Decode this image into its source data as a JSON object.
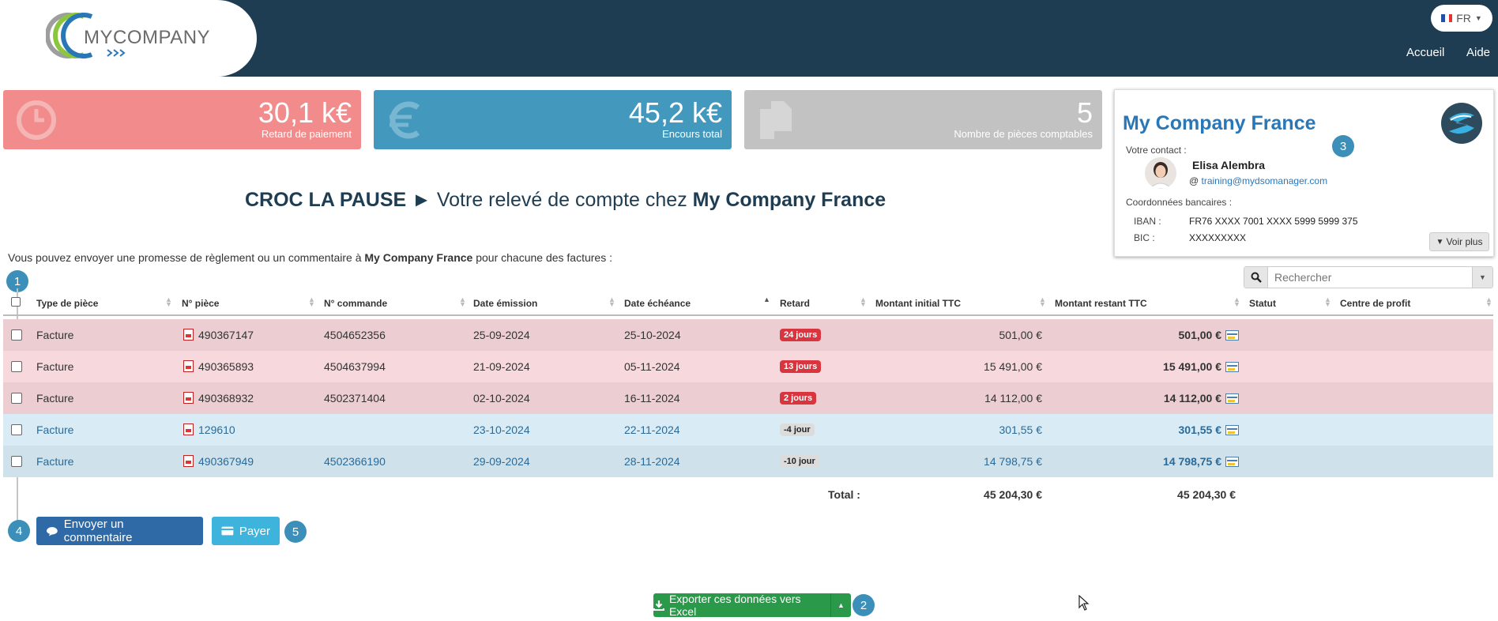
{
  "header": {
    "logo": "MYCOMPANY",
    "lang": "FR",
    "nav": [
      "Accueil",
      "Aide"
    ]
  },
  "kpis": [
    {
      "value": "30,1 k€",
      "label": "Retard de paiement",
      "color": "#f28b8b",
      "icon": "clock-icon"
    },
    {
      "value": "45,2 k€",
      "label": "Encours total",
      "color": "#4399bd",
      "icon": "euro-icon"
    },
    {
      "value": "5",
      "label": "Nombre de pièces comptables",
      "color": "#c2c2c2",
      "icon": "documents-icon"
    }
  ],
  "company": {
    "name": "My Company France",
    "contact_label": "Votre contact :",
    "contact_name": "Elisa Alembra",
    "contact_email": "training@mydsomanager.com",
    "bank_label": "Coordonnées bancaires :",
    "iban_label": "IBAN :",
    "iban": "FR76 XXXX 7001 XXXX 5999 5999 375",
    "bic_label": "BIC :",
    "bic": "XXXXXXXXX",
    "more": "Voir plus"
  },
  "heading": {
    "client": "CROC LA PAUSE",
    "arrow": "►",
    "text": "Votre relevé de compte chez",
    "company": "My Company France"
  },
  "intro": {
    "before": "Vous pouvez envoyer une promesse de règlement ou un commentaire à",
    "company": "My Company France",
    "after": "pour chacune des factures :"
  },
  "search": {
    "placeholder": "Rechercher"
  },
  "steps": [
    "1",
    "2",
    "3",
    "4",
    "5"
  ],
  "table": {
    "columns": [
      "Type de pièce",
      "N° pièce",
      "N° commande",
      "Date émission",
      "Date échéance",
      "Retard",
      "Montant initial TTC",
      "Montant restant TTC",
      "Statut",
      "Centre de profit"
    ],
    "rows": [
      {
        "type": "Facture",
        "piece": "490367147",
        "commande": "4504652356",
        "emission": "25-09-2024",
        "echeance": "25-10-2024",
        "retard": "24 jours",
        "initial": "501,00 €",
        "restant": "501,00 €",
        "late": true
      },
      {
        "type": "Facture",
        "piece": "490365893",
        "commande": "4504637994",
        "emission": "21-09-2024",
        "echeance": "05-11-2024",
        "retard": "13 jours",
        "initial": "15 491,00 €",
        "restant": "15 491,00 €",
        "late": true
      },
      {
        "type": "Facture",
        "piece": "490368932",
        "commande": "4502371404",
        "emission": "02-10-2024",
        "echeance": "16-11-2024",
        "retard": "2 jours",
        "initial": "14 112,00 €",
        "restant": "14 112,00 €",
        "late": true
      },
      {
        "type": "Facture",
        "piece": "129610",
        "commande": "",
        "emission": "23-10-2024",
        "echeance": "22-11-2024",
        "retard": "-4 jour",
        "initial": "301,55 €",
        "restant": "301,55 €",
        "late": false
      },
      {
        "type": "Facture",
        "piece": "490367949",
        "commande": "4502366190",
        "emission": "29-09-2024",
        "echeance": "28-11-2024",
        "retard": "-10 jour",
        "initial": "14 798,75 €",
        "restant": "14 798,75 €",
        "late": false
      }
    ],
    "total_label": "Total :",
    "total_initial": "45 204,30 €",
    "total_restant": "45 204,30 €"
  },
  "actions": {
    "comment": "Envoyer un commentaire",
    "pay": "Payer",
    "export": "Exporter ces données vers Excel"
  },
  "colors": {
    "header": "#1e3d52",
    "row_late_a": "#ebcdd2",
    "row_late_b": "#f7d8dc",
    "row_ok_a": "#d9ecf5",
    "row_ok_b": "#cfe1ea",
    "badge_late": "#d9353e",
    "badge_ok": "#dcdcdc",
    "accent": "#2a77b8"
  }
}
